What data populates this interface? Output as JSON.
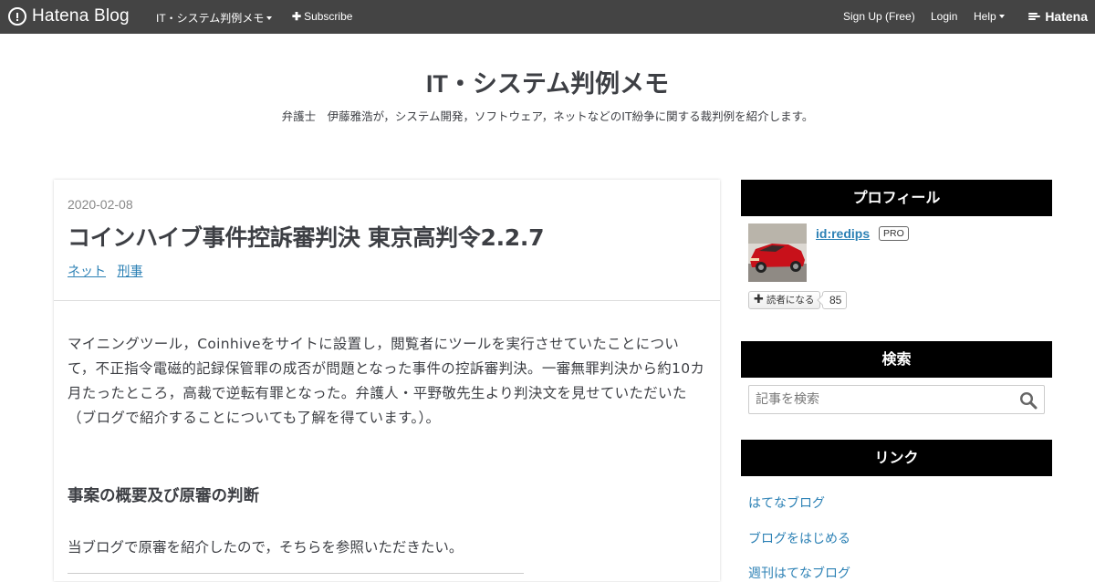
{
  "globalheader": {
    "logo_text": "Hatena Blog",
    "blog_menu_label": "IT・システム判例メモ",
    "subscribe_label": "Subscribe",
    "signup_label": "Sign Up (Free)",
    "login_label": "Login",
    "help_label": "Help",
    "hatena_label": "Hatena"
  },
  "blog": {
    "title": "IT・システム判例メモ",
    "description": "弁護士　伊藤雅浩が，システム開発，ソフトウェア，ネットなどのIT紛争に関する裁判例を紹介します。"
  },
  "entry": {
    "date": "2020-02-08",
    "title": "コインハイブ事件控訴審判決 東京高判令2.2.7",
    "categories": [
      "ネット",
      "刑事"
    ],
    "body": "マイニングツール，Coinhiveをサイトに設置し，閲覧者にツールを実行させていたことについて，不正指令電磁的記録保管罪の成否が問題となった事件の控訴審判決。一審無罪判決から約10カ月たったところ，高裁で逆転有罪となった。弁護人・平野敬先生より判決文を見せていただいた（ブログで紹介することについても了解を得ています。）。",
    "heading": "事案の概要及び原審の判断",
    "paragraph2": "当ブログで原審を紹介したので，そちらを参照いただきたい。"
  },
  "sidebar": {
    "profile": {
      "title": "プロフィール",
      "user_id": "id:redips",
      "badge": "PRO",
      "subscribe_label": "読者になる",
      "subscriber_count": "85"
    },
    "search": {
      "title": "検索",
      "placeholder": "記事を検索"
    },
    "links": {
      "title": "リンク",
      "items": [
        "はてなブログ",
        "ブログをはじめる",
        "週刊はてなブログ"
      ]
    }
  },
  "colors": {
    "header_bg": "#444444",
    "link": "#2c81b5",
    "module_title_bg": "#000000"
  }
}
